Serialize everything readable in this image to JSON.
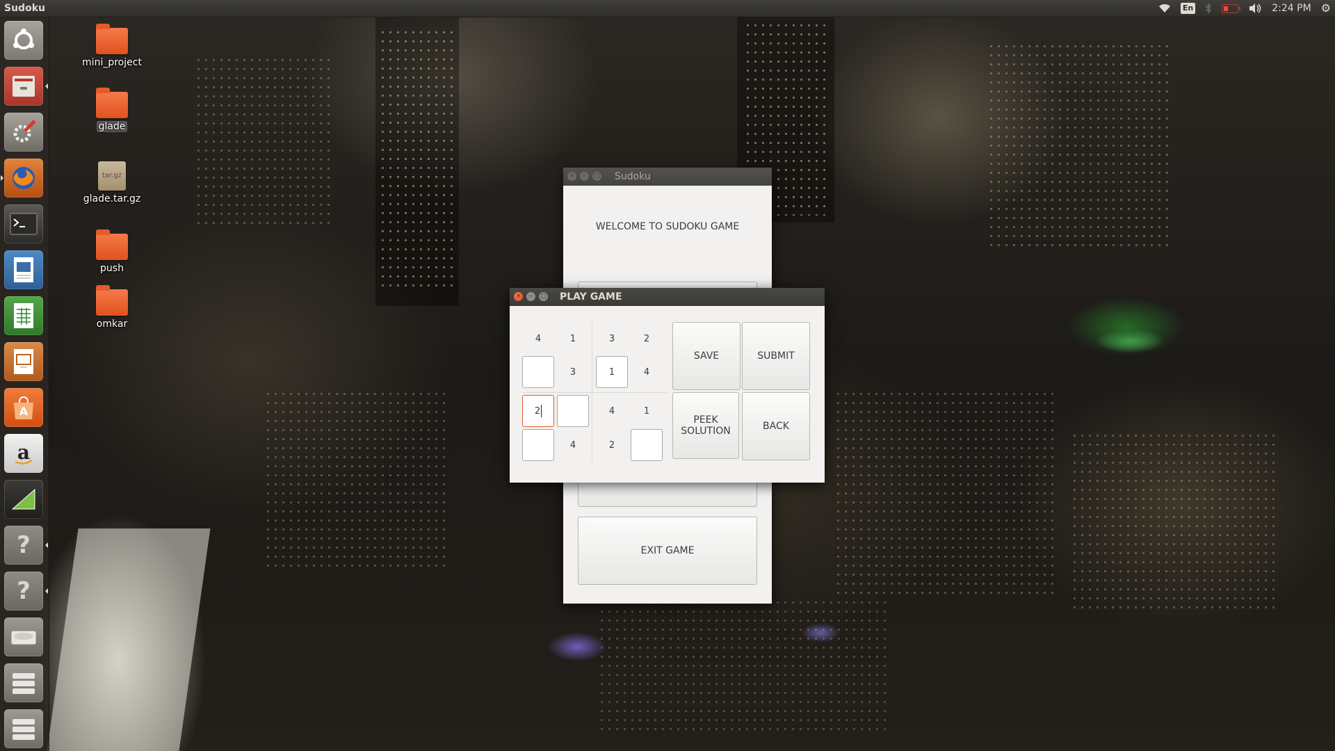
{
  "top_panel": {
    "app_title": "Sudoku",
    "lang": "En",
    "time": "2:24 PM"
  },
  "launcher": {
    "items": [
      {
        "name": "ubuntu-dash",
        "icon": "ubuntu-logo-icon"
      },
      {
        "name": "files",
        "icon": "file-cabinet-icon"
      },
      {
        "name": "system-settings",
        "icon": "settings-tools-icon"
      },
      {
        "name": "firefox",
        "icon": "firefox-icon"
      },
      {
        "name": "terminal",
        "icon": "terminal-icon"
      },
      {
        "name": "writer",
        "icon": "document-icon"
      },
      {
        "name": "calc",
        "icon": "spreadsheet-icon"
      },
      {
        "name": "impress",
        "icon": "presentation-icon"
      },
      {
        "name": "software-center",
        "icon": "shopping-bag-icon"
      },
      {
        "name": "amazon",
        "icon": "amazon-icon"
      },
      {
        "name": "geometry",
        "icon": "triangle-app-icon"
      },
      {
        "name": "unknown-1",
        "icon": "question-icon"
      },
      {
        "name": "unknown-2",
        "icon": "question-icon"
      },
      {
        "name": "drive",
        "icon": "drive-icon"
      },
      {
        "name": "workspaces",
        "icon": "workspace-icon"
      }
    ]
  },
  "desktop": {
    "icons": [
      {
        "label": "mini_project",
        "type": "folder"
      },
      {
        "label": "glade",
        "type": "folder",
        "selected": true
      },
      {
        "label": "glade.tar.gz",
        "type": "archive",
        "badge": "tar.gz"
      },
      {
        "label": "push",
        "type": "folder"
      },
      {
        "label": "omkar",
        "type": "folder"
      }
    ]
  },
  "welcome_window": {
    "title": "Sudoku",
    "welcome_text": "WELCOME TO SUDOKU GAME",
    "exit_label": "EXIT GAME"
  },
  "play_window": {
    "title": "PLAY GAME",
    "grid": [
      [
        "4",
        "1",
        "3",
        "2"
      ],
      [
        {
          "input": ""
        },
        "3",
        {
          "input": "1"
        },
        "4"
      ],
      [
        {
          "input": "2",
          "focused": true
        },
        {
          "input": ""
        },
        "4",
        "1"
      ],
      [
        {
          "input": ""
        },
        "4",
        "2",
        {
          "input": ""
        }
      ]
    ],
    "buttons": {
      "save": "SAVE",
      "submit": "SUBMIT",
      "peek": "PEEK SOLUTION",
      "back": "BACK"
    }
  },
  "colors": {
    "accent": "#e05a2a",
    "panel": "#3a3935",
    "window_bg": "#f2f1f0"
  }
}
